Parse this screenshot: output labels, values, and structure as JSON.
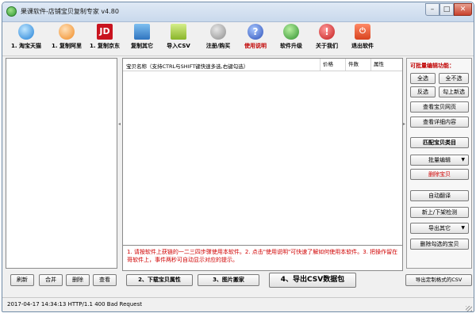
{
  "window": {
    "title": "果课软件-店铺宝贝复制专家  v4.80",
    "min_glyph": "–",
    "max_glyph": "□",
    "close_glyph": "✕"
  },
  "toolbar": [
    {
      "label": "1. 淘宝天猫",
      "icon": "qq-penguin-icon",
      "red": false
    },
    {
      "label": "1. 复制阿里",
      "icon": "alibaba-icon",
      "red": false
    },
    {
      "label": "1. 复制京东",
      "icon": "jd-logo-icon",
      "glyph": "JD",
      "red": false
    },
    {
      "label": "复制其它",
      "icon": "computer-icon",
      "red": false
    },
    {
      "label": "导入CSV",
      "icon": "csv-import-icon",
      "red": false
    },
    {
      "label": "注册/购买",
      "icon": "key-icon",
      "red": false
    },
    {
      "label": "使用说明",
      "icon": "help-icon",
      "glyph": "?",
      "red": true
    },
    {
      "label": "软件升级",
      "icon": "update-globe-icon",
      "red": false
    },
    {
      "label": "关于我们",
      "icon": "about-icon",
      "glyph": "!",
      "red": false
    },
    {
      "label": "退出软件",
      "icon": "exit-icon",
      "glyph": "⏻",
      "red": false
    }
  ],
  "table": {
    "headers": {
      "name": "宝贝名称（支持CTRL与SHIFT键快速多选,右键勾选）",
      "price": "价格",
      "qty": "件数",
      "attr": "属性"
    },
    "notice": "1. 请按软件上获链的一二三四步骤使用本软件。2. 点击\"使用说明\"可快速了解如何使用本软件。3. 把操作留在哥软件上，事件两秒可自动显示对应的提示。"
  },
  "right_panel": {
    "title": "可批量编辑功能：",
    "select_all": "全选",
    "deselect_all": "全不选",
    "invert": "反选",
    "check_up": "勾上新选",
    "view_page": "查看宝贝网页",
    "view_detail": "查看详细内容",
    "match_category": "匹配宝贝类目",
    "batch_edit": "批量编辑",
    "delete_items": "删除宝贝",
    "auto_translate": "自动翻译",
    "listing_check": "新上/下架检测",
    "export_other": "导出其它",
    "delete_checked": "删除勾选的宝贝",
    "export_custom": "导出定制格式的CSV",
    "dropdown_glyph": "▼"
  },
  "bottom_buttons": {
    "refresh": "刷新",
    "merge": "合并",
    "delete": "删除",
    "view": "查看",
    "step2": "2、下载宝贝属性",
    "step3": "3、图片搬家",
    "step4": "4、导出CSV数据包"
  },
  "status": {
    "text": "2017-04-17 14:34:13 HTTP/1.1 400 Bad Request"
  }
}
